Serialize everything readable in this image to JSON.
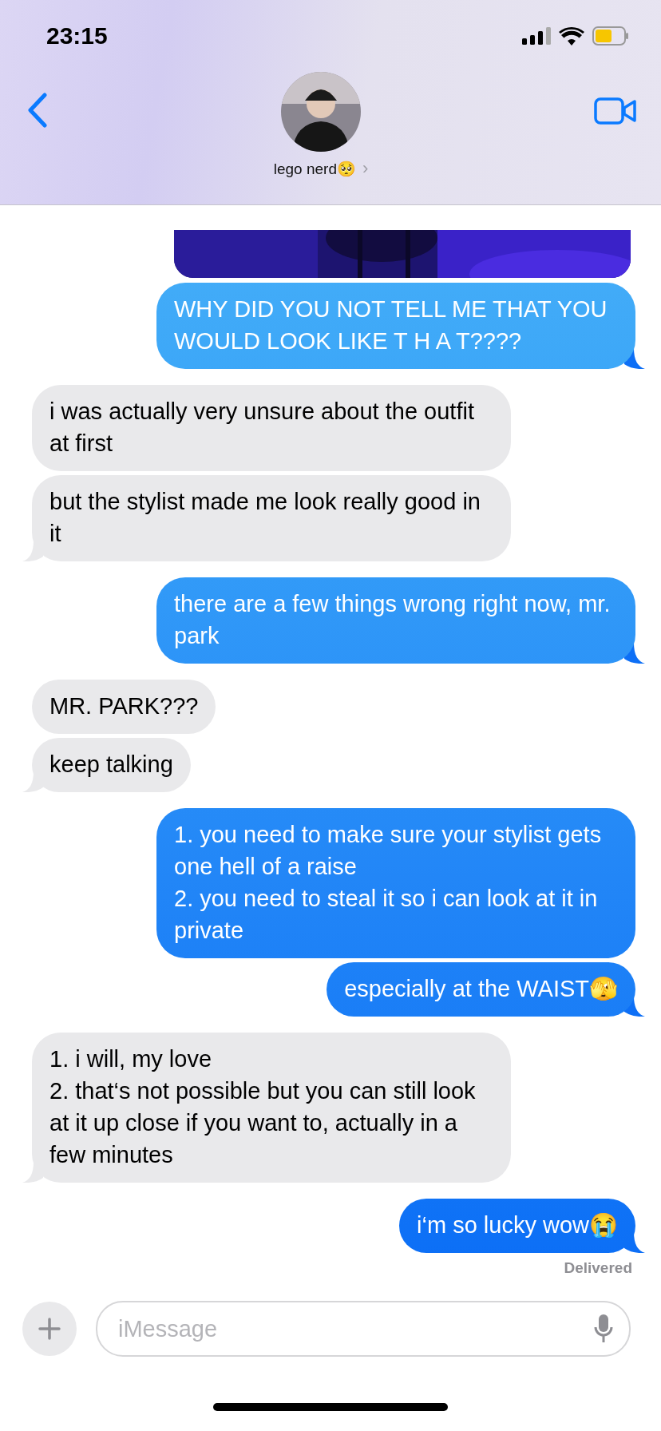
{
  "status_bar": {
    "time": "23:15"
  },
  "header": {
    "contact_name": "lego nerd🥺",
    "chevron": "›"
  },
  "messages": [
    {
      "kind": "picture"
    },
    {
      "kind": "sent",
      "text": "WHY DID YOU NOT TELL ME THAT YOU WOULD LOOK LIKE T H A T????"
    },
    {
      "kind": "received",
      "text": "i was actually very unsure about the outfit at first"
    },
    {
      "kind": "received",
      "text": "but the stylist made me look really good in it"
    },
    {
      "kind": "sent",
      "text": "there are a few things wrong right now, mr. park"
    },
    {
      "kind": "received",
      "text": "MR. PARK???"
    },
    {
      "kind": "received",
      "text": "keep talking"
    },
    {
      "kind": "sent",
      "text": "1. you need to make sure your stylist gets one hell of a raise\n2. you need to steal it so i can look at it in private"
    },
    {
      "kind": "sent",
      "text": "especially at the WAIST🫣"
    },
    {
      "kind": "received",
      "text": "1. i will, my love\n2. that‘s not possible but you can still look at it up close if you want to, actually in a few minutes"
    },
    {
      "kind": "sent",
      "text": "i‘m so lucky wow😭"
    }
  ],
  "receipt": "Delivered",
  "composer": {
    "placeholder": "iMessage"
  }
}
